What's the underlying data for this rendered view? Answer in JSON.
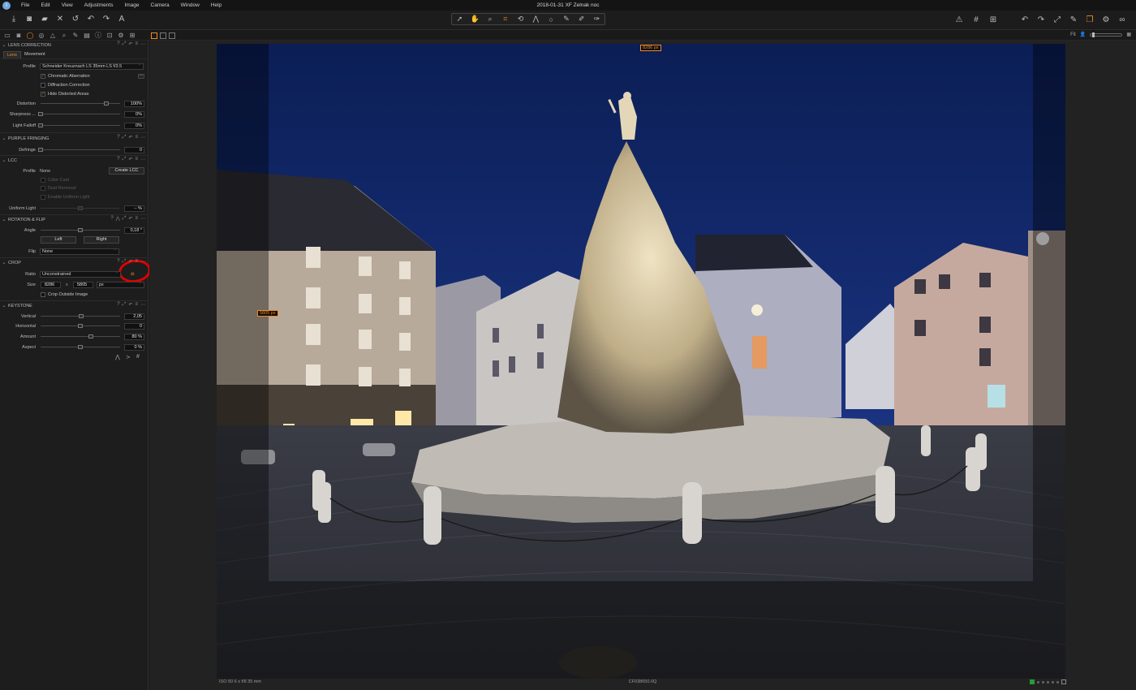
{
  "menubar": {
    "items": [
      "File",
      "Edit",
      "View",
      "Adjustments",
      "Image",
      "Camera",
      "Window",
      "Help"
    ],
    "title": "2018-01-31 XF Zelnak noc"
  },
  "toolbar": {
    "left_icons": [
      "import-icon",
      "camera-icon",
      "export-icon",
      "delete-icon",
      "undo-all-icon",
      "undo-icon",
      "redo-icon",
      "text-icon"
    ],
    "center_icons": [
      "select-icon",
      "pan-icon",
      "loupe-icon",
      "crop-icon",
      "rotate-icon",
      "keystone-icon",
      "spot-icon",
      "brush-icon",
      "eraser-icon",
      "gradient-icon"
    ],
    "right_icons": [
      "warning-icon",
      "grid-icon",
      "guides-icon",
      "rotate-left-icon",
      "rotate-right-icon",
      "expand-icon",
      "edit-icon",
      "copy-apply-icon",
      "settings-icon",
      "glasses-icon"
    ]
  },
  "zoom": {
    "label": "Fit"
  },
  "lens_correction": {
    "header": "LENS CORRECTION",
    "tabs": [
      "Lens",
      "Movement"
    ],
    "profile_label": "Profile",
    "profile_value": "Schneider Kreuznach LS 35mm LS f/3.5",
    "checkboxes": [
      {
        "label": "Chromatic Aberration",
        "checked": true
      },
      {
        "label": "Diffraction Correction",
        "checked": false
      },
      {
        "label": "Hide Distorted Areas",
        "checked": true
      }
    ],
    "sliders": [
      {
        "label": "Distortion",
        "value": "100%",
        "pos": 0.82
      },
      {
        "label": "Sharpness ...",
        "value": "0%",
        "pos": 0.0
      },
      {
        "label": "Light Falloff",
        "value": "0%",
        "pos": 0.0
      }
    ]
  },
  "purple_fringing": {
    "header": "PURPLE FRINGING",
    "label": "Defringe",
    "value": "0"
  },
  "lcc": {
    "header": "LCC",
    "profile_label": "Profile",
    "profile_value": "None",
    "create_button": "Create LCC",
    "checkboxes": [
      "Color Cast",
      "Dust Removal",
      "Enable Uniform Light"
    ],
    "uniform_label": "Uniform Light",
    "uniform_value": "-- %"
  },
  "rotation": {
    "header": "ROTATION & FLIP",
    "angle_label": "Angle",
    "angle_value": "0,18 °",
    "left_button": "Left",
    "right_button": "Right",
    "flip_label": "Flip",
    "flip_value": "None"
  },
  "crop": {
    "header": "CROP",
    "ratio_label": "Ratio",
    "ratio_value": "Unconstrained",
    "size_label": "Size",
    "width": "8286",
    "x": "x",
    "height": "5805",
    "unit": "px",
    "outside_label": "Crop Outside Image"
  },
  "keystone": {
    "header": "KEYSTONE",
    "sliders": [
      {
        "label": "Vertical",
        "value": "2,05",
        "pos": 0.51
      },
      {
        "label": "Horizontal",
        "value": "0",
        "pos": 0.5
      },
      {
        "label": "Amount",
        "value": "80 %",
        "pos": 0.63
      },
      {
        "label": "Aspect",
        "value": "0 %",
        "pos": 0.5
      }
    ]
  },
  "viewer": {
    "width_badge": "8286 px",
    "height_badge": "5805 px",
    "status_left": "ISO 50  6 s  f/8  35 mm",
    "status_center": "CF038650.IIQ"
  }
}
